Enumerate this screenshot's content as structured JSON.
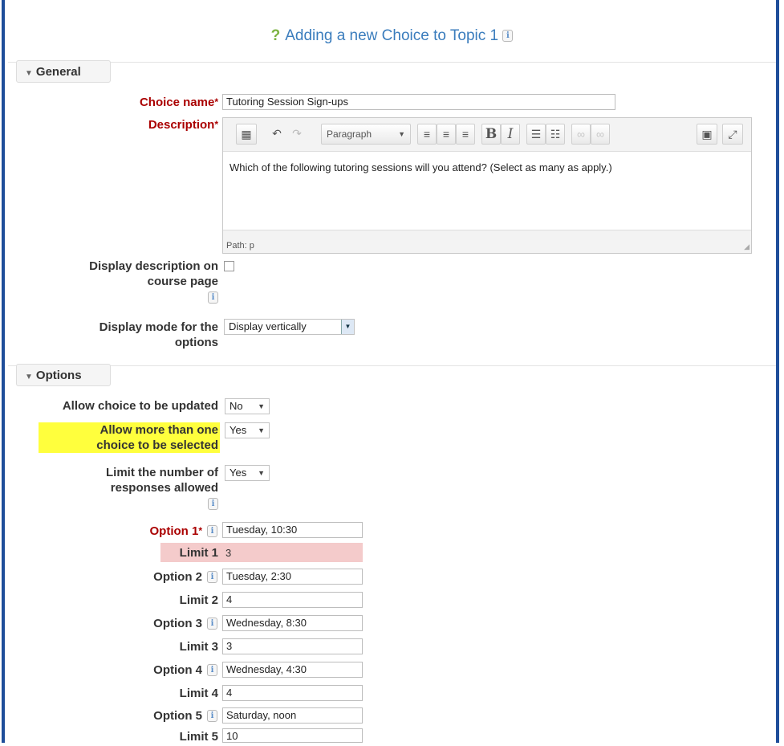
{
  "page": {
    "title": "Adding a new Choice to Topic 1"
  },
  "general": {
    "legend": "General",
    "choice_name_label": "Choice name",
    "choice_name_value": "Tutoring Session Sign-ups",
    "description_label": "Description",
    "editor": {
      "format_select": "Paragraph",
      "content": "Which of the following tutoring sessions will you attend? (Select as many as apply.)",
      "path": "Path: p"
    },
    "display_desc_label": [
      "Display description on",
      "course page"
    ],
    "display_mode_label": [
      "Display mode for the",
      "options"
    ],
    "display_mode_value": "Display vertically"
  },
  "options": {
    "legend": "Options",
    "allow_update_label": "Allow choice to be updated",
    "allow_update_value": "No",
    "allow_multiple_label": [
      "Allow more than one",
      "choice to be selected"
    ],
    "allow_multiple_value": "Yes",
    "limit_answers_label": [
      "Limit the number of",
      "responses allowed"
    ],
    "limit_answers_value": "Yes",
    "items": [
      {
        "option_label": "Option 1",
        "option_value": "Tuesday, 10:30",
        "limit_label": "Limit 1",
        "limit_value": "3"
      },
      {
        "option_label": "Option 2",
        "option_value": "Tuesday, 2:30",
        "limit_label": "Limit 2",
        "limit_value": "4"
      },
      {
        "option_label": "Option 3",
        "option_value": "Wednesday, 8:30",
        "limit_label": "Limit 3",
        "limit_value": "3"
      },
      {
        "option_label": "Option 4",
        "option_value": "Wednesday, 4:30",
        "limit_label": "Limit 4",
        "limit_value": "4"
      },
      {
        "option_label": "Option 5",
        "option_value": "Saturday, noon",
        "limit_label": "Limit 5",
        "limit_value": "10"
      }
    ]
  },
  "icons": [
    "help-question-icon",
    "info-icon",
    "triangle-down-icon",
    "source-code-icon",
    "undo-icon",
    "redo-icon",
    "align-left-icon",
    "align-center-icon",
    "align-right-icon",
    "bold-icon",
    "italic-icon",
    "bullet-list-icon",
    "numbered-list-icon",
    "link-icon",
    "unlink-icon",
    "image-icon",
    "fullscreen-icon",
    "resize-handle-icon"
  ],
  "colors": {
    "border": "#1f4e9a",
    "title": "#3b7dbd",
    "required": "#aa0000",
    "highlight": "#ffff3d",
    "error_bg": "#f4cbcb",
    "question_mark": "#7cb342"
  }
}
